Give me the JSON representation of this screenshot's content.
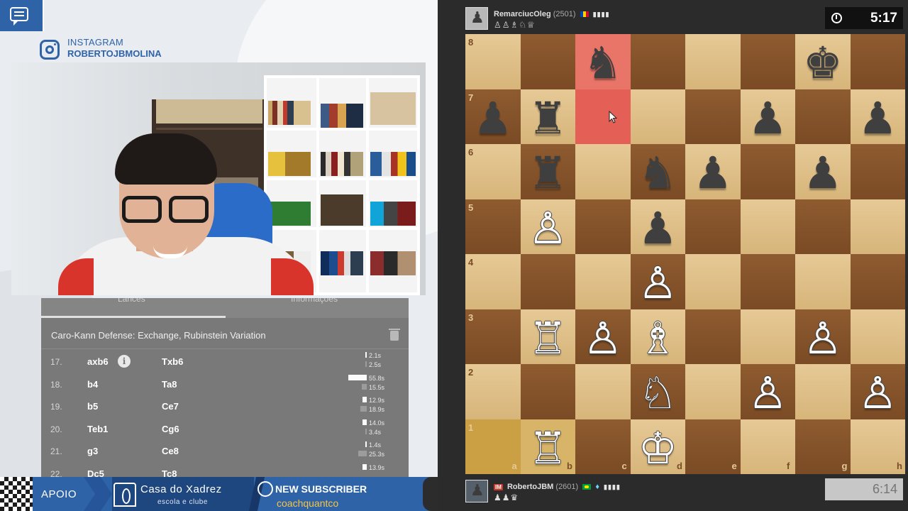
{
  "stream": {
    "instagram_label": "INSTAGRAM",
    "instagram_handle": "ROBERTOJBMOLINA"
  },
  "moves_panel": {
    "tab_moves": "Lances",
    "tab_info": "Informações",
    "opening": "Caro-Kann Defense: Exchange, Rubinstein Variation",
    "rows": [
      {
        "num": "17.",
        "white": "axb6",
        "black": "Txb6",
        "t1": "2.1s",
        "t2": "2.5s",
        "f1": 0.03,
        "f2": 0.04,
        "info": "i"
      },
      {
        "num": "18.",
        "white": "b4",
        "black": "Ta8",
        "t1": "55.8s",
        "t2": "15.5s",
        "f1": 1.0,
        "f2": 0.28
      },
      {
        "num": "19.",
        "white": "b5",
        "black": "Ce7",
        "t1": "12.9s",
        "t2": "18.9s",
        "f1": 0.23,
        "f2": 0.34
      },
      {
        "num": "20.",
        "white": "Teb1",
        "black": "Cg6",
        "t1": "14.0s",
        "t2": "3.4s",
        "f1": 0.25,
        "f2": 0.06
      },
      {
        "num": "21.",
        "white": "g3",
        "black": "Ce8",
        "t1": "1.4s",
        "t2": "25.3s",
        "f1": 0.03,
        "f2": 0.45
      },
      {
        "num": "22.",
        "white": "Dc5",
        "black": "Tc8",
        "t1": "13.9s",
        "t2": "",
        "f1": 0.25,
        "f2": 0
      }
    ]
  },
  "bottom_bar": {
    "apoio": "APOIO",
    "sponsor_name": "Casa do Xadrez",
    "sponsor_tag": "escola e clube",
    "new_sub_label": "NEW SUBSCRIBER",
    "new_sub_name": "coachquantco"
  },
  "top_player": {
    "name": "RemarciucOleg",
    "rating": "(2501)",
    "captured": "♙♙♗♘♕",
    "clock": "5:17",
    "flag_colors": [
      "#0046ae",
      "#ffd200",
      "#cc092f"
    ]
  },
  "bottom_player": {
    "title": "IM",
    "name": "RobertoJBM",
    "rating": "(2601)",
    "captured": "♟♟♛",
    "clock": "6:14",
    "flag_colors": [
      "#009c3b",
      "#ffdf00"
    ]
  },
  "board": {
    "files": [
      "a",
      "b",
      "c",
      "d",
      "e",
      "f",
      "g",
      "h"
    ],
    "ranks": [
      "8",
      "7",
      "6",
      "5",
      "4",
      "3",
      "2",
      "1"
    ],
    "highlight": [
      "c8",
      "c7"
    ],
    "last_move": [
      "a1",
      "b1"
    ],
    "pieces": [
      {
        "sq": "c8",
        "p": "♞",
        "c": "black"
      },
      {
        "sq": "g8",
        "p": "♚",
        "c": "black"
      },
      {
        "sq": "a7",
        "p": "♟",
        "c": "black"
      },
      {
        "sq": "b7",
        "p": "♜",
        "c": "black"
      },
      {
        "sq": "f7",
        "p": "♟",
        "c": "black"
      },
      {
        "sq": "h7",
        "p": "♟",
        "c": "black"
      },
      {
        "sq": "b6",
        "p": "♜",
        "c": "black"
      },
      {
        "sq": "d6",
        "p": "♞",
        "c": "black"
      },
      {
        "sq": "e6",
        "p": "♟",
        "c": "black"
      },
      {
        "sq": "g6",
        "p": "♟",
        "c": "black"
      },
      {
        "sq": "b5",
        "p": "♙",
        "c": "white"
      },
      {
        "sq": "d5",
        "p": "♟",
        "c": "black"
      },
      {
        "sq": "d4",
        "p": "♙",
        "c": "white"
      },
      {
        "sq": "b3",
        "p": "♖",
        "c": "white"
      },
      {
        "sq": "c3",
        "p": "♙",
        "c": "white"
      },
      {
        "sq": "d3",
        "p": "♗",
        "c": "white"
      },
      {
        "sq": "g3",
        "p": "♙",
        "c": "white"
      },
      {
        "sq": "d2",
        "p": "♘",
        "c": "white"
      },
      {
        "sq": "f2",
        "p": "♙",
        "c": "white"
      },
      {
        "sq": "h2",
        "p": "♙",
        "c": "white"
      },
      {
        "sq": "b1",
        "p": "♖",
        "c": "white"
      },
      {
        "sq": "d1",
        "p": "♔",
        "c": "white"
      }
    ]
  }
}
